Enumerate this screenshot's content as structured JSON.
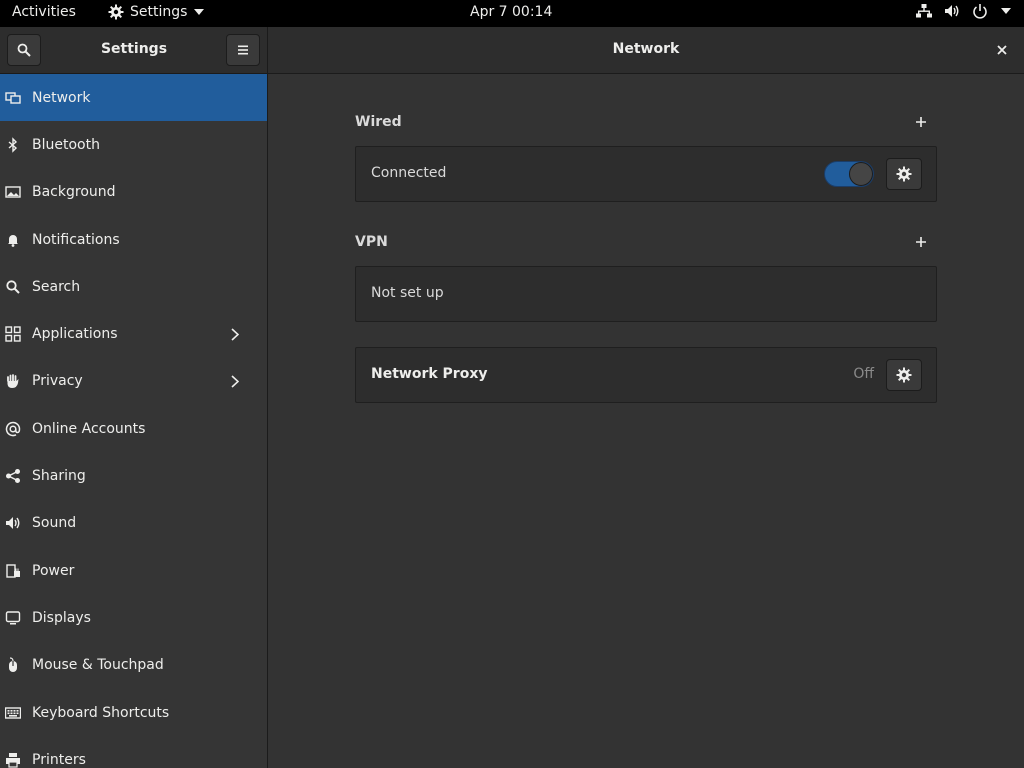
{
  "topbar": {
    "activities": "Activities",
    "app_name": "Settings",
    "clock": "Apr 7  00:14",
    "status_icons": [
      "network-wired-icon",
      "volume-icon",
      "power-icon",
      "menu-down-icon"
    ]
  },
  "headerbar": {
    "left_title": "Settings",
    "main_title": "Network"
  },
  "sidebar": {
    "items": [
      {
        "label": "Network",
        "icon": "network-icon",
        "active": true,
        "chevron": false
      },
      {
        "label": "Bluetooth",
        "icon": "bluetooth-icon",
        "active": false,
        "chevron": false
      },
      {
        "label": "Background",
        "icon": "background-icon",
        "active": false,
        "chevron": false
      },
      {
        "label": "Notifications",
        "icon": "bell-icon",
        "active": false,
        "chevron": false
      },
      {
        "label": "Search",
        "icon": "search-icon",
        "active": false,
        "chevron": false
      },
      {
        "label": "Applications",
        "icon": "apps-grid-icon",
        "active": false,
        "chevron": true
      },
      {
        "label": "Privacy",
        "icon": "hand-icon",
        "active": false,
        "chevron": true
      },
      {
        "label": "Online Accounts",
        "icon": "at-icon",
        "active": false,
        "chevron": false
      },
      {
        "label": "Sharing",
        "icon": "share-icon",
        "active": false,
        "chevron": false
      },
      {
        "label": "Sound",
        "icon": "speaker-icon",
        "active": false,
        "chevron": false
      },
      {
        "label": "Power",
        "icon": "power-plug-icon",
        "active": false,
        "chevron": false
      },
      {
        "label": "Displays",
        "icon": "display-icon",
        "active": false,
        "chevron": false
      },
      {
        "label": "Mouse & Touchpad",
        "icon": "mouse-icon",
        "active": false,
        "chevron": false
      },
      {
        "label": "Keyboard Shortcuts",
        "icon": "keyboard-icon",
        "active": false,
        "chevron": false
      },
      {
        "label": "Printers",
        "icon": "printer-icon",
        "active": false,
        "chevron": false
      }
    ]
  },
  "main": {
    "wired": {
      "title": "Wired",
      "status": "Connected",
      "toggle_on": true
    },
    "vpn": {
      "title": "VPN",
      "status": "Not set up"
    },
    "proxy": {
      "title": "Network Proxy",
      "status": "Off"
    }
  },
  "colors": {
    "accent": "#215d9c",
    "sidebar_bg": "#353535",
    "main_bg": "#333333",
    "topbar_bg": "#000000"
  }
}
